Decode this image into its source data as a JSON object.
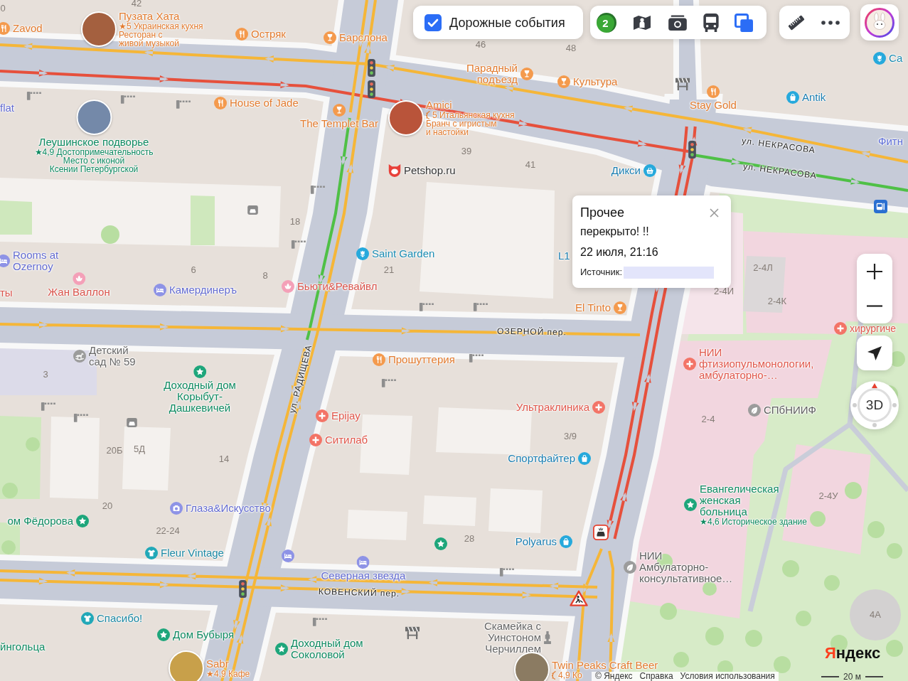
{
  "traffic_toggle": {
    "label": "Дорожные события",
    "checked": true
  },
  "layers_toolbar": {
    "traffic_score": "2",
    "tools": [
      {
        "selected": false
      },
      {
        "selected": false
      },
      {
        "selected": false
      },
      {
        "selected": true
      }
    ]
  },
  "map": {
    "places": [
      {
        "kind": "food",
        "name": [
          "Zavod"
        ]
      },
      {
        "kind": "food",
        "name": [
          "Пузата Хата"
        ],
        "details": [
          "★5 Украинская кухня",
          "Ресторан с",
          "живой музыкой"
        ],
        "photo": true
      },
      {
        "kind": "food",
        "name": [
          "Остряк"
        ]
      },
      {
        "kind": "bar",
        "name": [
          "Барслона"
        ]
      },
      {
        "kind": "bar",
        "name": [
          "Парадный",
          "подъезд"
        ]
      },
      {
        "kind": "bar",
        "name": [
          "Культура"
        ]
      },
      {
        "kind": "food",
        "name": [
          "Stay Gold"
        ]
      },
      {
        "kind": "shop",
        "name": [
          "Antik"
        ]
      },
      {
        "kind": "flowers",
        "name": [
          "Са"
        ]
      },
      {
        "kind": "hotel",
        "name": [
          "flat"
        ]
      },
      {
        "kind": "food",
        "name": [
          "House of Jade"
        ]
      },
      {
        "kind": "bar",
        "name": [
          "The Templet Bar"
        ]
      },
      {
        "kind": "food",
        "name": [
          "Amici"
        ],
        "details": [
          "5 Итальянская кухня",
          "Бранч с игристым",
          "и настойки"
        ],
        "photo": true,
        "award": true
      },
      {
        "kind": "sight",
        "name": [
          "Леушинское подворье"
        ],
        "details": [
          "★4,9 Достопримечательность",
          "Место с иконой",
          "Ксении Петербургской"
        ],
        "photo": true
      },
      {
        "kind": "pets",
        "name": [
          "Petshop.ru"
        ]
      },
      {
        "kind": "grocery",
        "name": [
          "Дикси"
        ]
      },
      {
        "kind": "fitness",
        "name": [
          "Фитн"
        ]
      },
      {
        "kind": "hotel",
        "name": [
          "Rooms at",
          "Ozernoy"
        ]
      },
      {
        "kind": "flowers",
        "name": [
          "Saint Garden"
        ]
      },
      {
        "kind": "shop",
        "name": [
          "L1"
        ]
      },
      {
        "kind": "beauty",
        "name": [
          "ты"
        ]
      },
      {
        "kind": "beauty",
        "name": [
          "Жан Валлон"
        ]
      },
      {
        "kind": "hotel",
        "name": [
          "Камердинеръ"
        ]
      },
      {
        "kind": "beauty",
        "name": [
          "Бьюти&Ревайвл"
        ]
      },
      {
        "kind": "bar",
        "name": [
          "El Tinto"
        ]
      },
      {
        "kind": "kindergarten",
        "name": [
          "Детский",
          "сад № 59"
        ]
      },
      {
        "kind": "sight",
        "name": [
          "Доходный дом",
          "Корыбут-",
          "Дашкевичей"
        ]
      },
      {
        "kind": "food",
        "name": [
          "Прошуттерия"
        ]
      },
      {
        "kind": "medical",
        "name": [
          "Epijay"
        ]
      },
      {
        "kind": "medical",
        "name": [
          "Ситилаб"
        ]
      },
      {
        "kind": "medical",
        "name": [
          "Ультраклиника"
        ]
      },
      {
        "kind": "shop",
        "name": [
          "Спортфайтер"
        ]
      },
      {
        "kind": "optics",
        "name": [
          "Глаза&Искусство"
        ]
      },
      {
        "kind": "sight",
        "name": [
          "ом Фёдорова"
        ]
      },
      {
        "kind": "clothes",
        "name": [
          "Fleur Vintage"
        ]
      },
      {
        "kind": "shop",
        "name": [
          "Polyarus"
        ]
      },
      {
        "kind": "hotel",
        "name": [
          "Северная звезда"
        ]
      },
      {
        "kind": "clothes",
        "name": [
          "Спасибо!"
        ]
      },
      {
        "kind": "sight",
        "name": [
          "Дом Бубыря"
        ]
      },
      {
        "kind": "sight",
        "name": [
          "йнгольца"
        ]
      },
      {
        "kind": "sight",
        "name": [
          "Доходный дом",
          "Соколовой"
        ]
      },
      {
        "kind": "food",
        "name": [
          "Sabr"
        ],
        "details": [
          "★4,9 Кафе"
        ],
        "photo": true
      },
      {
        "kind": "monument",
        "name": [
          "Скамейка с",
          "Уинстоном",
          "Черчиллем"
        ]
      },
      {
        "kind": "bar",
        "name": [
          "Twin Peaks Craft Beer"
        ],
        "details": [
          "4,9 Ко"
        ],
        "photo": true,
        "award": true
      },
      {
        "kind": "medical",
        "name": [
          "НИИ",
          "фтизиопульмонологии,",
          "амбулаторно-…"
        ]
      },
      {
        "kind": "org",
        "name": [
          "СПбНИИФ"
        ]
      },
      {
        "kind": "sight",
        "name": [
          "Евангелическая",
          "женская",
          "больница"
        ],
        "details": [
          "★4,6 Историческое здание"
        ]
      },
      {
        "kind": "org",
        "name": [
          "НИИ",
          "Амбулаторно-",
          "консультативное…"
        ]
      },
      {
        "kind": "medical",
        "name": [
          "хирургиче"
        ]
      }
    ],
    "house_numbers": [
      "0",
      "42",
      "46",
      "48",
      "39",
      "41",
      "18",
      "6",
      "8",
      "21",
      "3",
      "20Б",
      "5Д",
      "14",
      "20",
      "22-24",
      "3/9",
      "28",
      "2-4Л",
      "2-4И",
      "2-4К",
      "2-4",
      "2-4У",
      "4А"
    ],
    "street_labels": [
      "ул. НЕКРАСОВА",
      "ул. НЕКРАСОВА",
      "ОЗЕРНОЙ пер.",
      "ул. РАДИЩЕВА",
      "КОВЕНСКИЙ пер."
    ],
    "traffic_lines": [
      {
        "color": "#f5b638"
      },
      {
        "color": "#e6503c"
      },
      {
        "color": "#4fc046"
      },
      {
        "color": "#f5b638"
      },
      {
        "color": "#4fc046"
      },
      {
        "color": "#f5b638"
      },
      {
        "color": "#f5b638"
      },
      {
        "color": "#f5b638"
      },
      {
        "color": "#f5b638"
      },
      {
        "color": "#f5b638"
      },
      {
        "color": "#e6503c"
      },
      {
        "color": "#e6503c"
      },
      {
        "color": "#f5b638"
      },
      {
        "color": "#f5b638"
      }
    ]
  },
  "event_popup": {
    "title": "Прочее",
    "description": "перекрыто! !!",
    "time": "22 июля, 21:16",
    "source_label": "Источник:"
  },
  "map_controls": {
    "view_mode": "3D"
  },
  "logo": "Яндекс",
  "footer": {
    "links": [
      "© Яндекс",
      "Справка",
      "Условия использования"
    ],
    "scale": "20 м"
  }
}
